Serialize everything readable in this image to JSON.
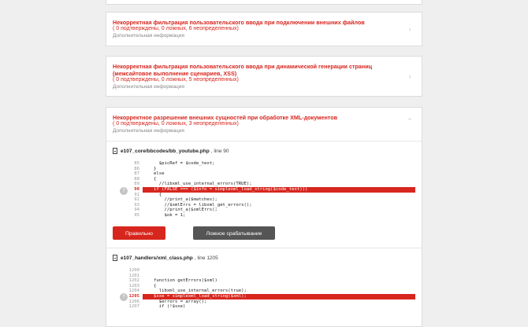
{
  "vulnerabilities": [
    {
      "title": "Некорректная фильтрация пользовательского ввода при подключении внешних файлов",
      "stats": "( 0 подтверждены, 0 ложных, 6 неопределенных)",
      "more": "Дополнительная информация"
    },
    {
      "title_line1": "Некорректная фильтрация пользовательского ввода при динамической генерации страниц",
      "title_line2": "(межсайтовое выполнение сценариев, XSS)",
      "stats": "( 0 подтверждены, 0 ложных, 5 неопределенных)",
      "more": "Дополнительная информация"
    },
    {
      "title": "Некорректное разрешение внешних сущностей при обработке XML-документов",
      "stats": "( 0 подтверждены, 0 ложных, 3 неопределенных)",
      "more": "Дополнительная информация"
    }
  ],
  "findings": [
    {
      "file": "e107_core/bbcodes/bb_youtube.php",
      "line_label": ", line 90",
      "marker": "?",
      "code": [
        {
          "n": "85",
          "t": "  $picRef = $code_text;"
        },
        {
          "n": "86",
          "t": "}"
        },
        {
          "n": "87",
          "t": "else"
        },
        {
          "n": "88",
          "t": "{"
        },
        {
          "n": "89",
          "t": "  //libxml_use_internal_errors(TRUE);"
        },
        {
          "n": "90",
          "t": "if (FALSE === ($info = simplexml_load_string($code_text)))",
          "hl": true
        },
        {
          "n": "91",
          "t": "  {"
        },
        {
          "n": "92",
          "t": "    //print_a($matches);"
        },
        {
          "n": "93",
          "t": "    //$xmlErrs = libxml_get_errors();"
        },
        {
          "n": "94",
          "t": "    //print_a($xmlErrs);"
        },
        {
          "n": "95",
          "t": "    $ok = 1;"
        }
      ],
      "buttons": {
        "correct": "Правильно",
        "false_positive": "Ложное срабатывание"
      }
    },
    {
      "file": "e107_handlers/xml_class.php",
      "line_label": ", line 1205",
      "marker": "?",
      "code": [
        {
          "n": "1200",
          "t": ""
        },
        {
          "n": "1201",
          "t": ""
        },
        {
          "n": "1202",
          "t": "function getErrors($xml)"
        },
        {
          "n": "1203",
          "t": "{"
        },
        {
          "n": "1204",
          "t": "  libxml_use_internal_errors(true);"
        },
        {
          "n": "1205",
          "t": "$sxe = simplexml_load_string($xml);",
          "hl": true
        },
        {
          "n": "1206",
          "t": "  $errors = array();"
        },
        {
          "n": "1207",
          "t": "  if (!$sxe)"
        }
      ]
    }
  ],
  "icons": {
    "collapsed": "chevron-right-icon",
    "expanded": "chevron-up-icon",
    "file": "file-icon"
  },
  "colors": {
    "accent": "#d7261e",
    "secondary_button": "#555555",
    "background": "#efefef"
  }
}
